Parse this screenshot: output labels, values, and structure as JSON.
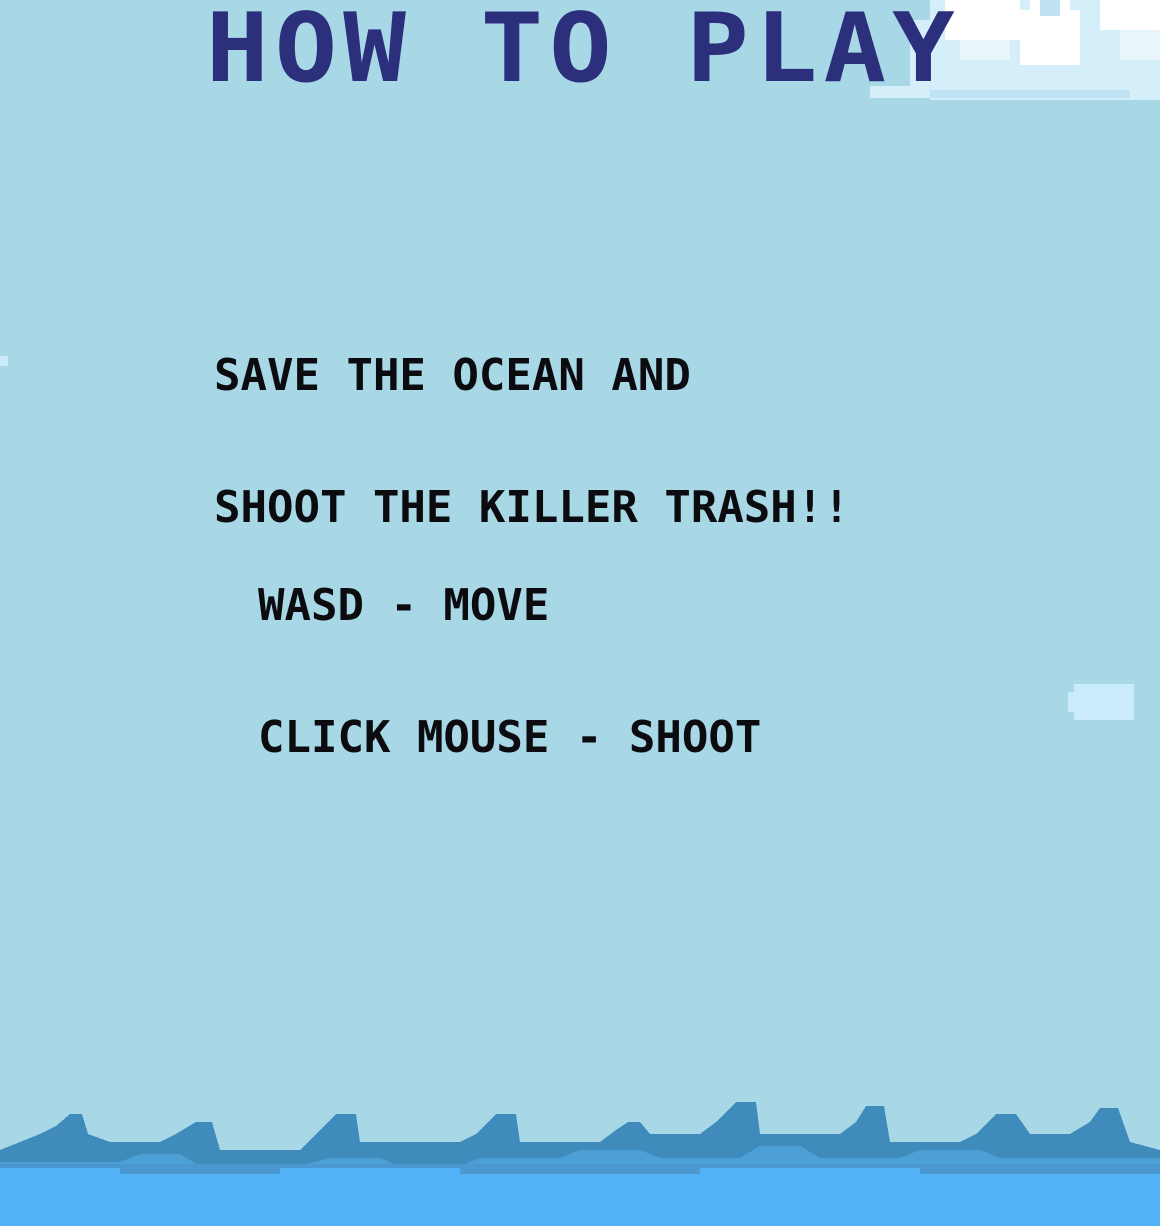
{
  "screen": {
    "title": "HOW TO PLAY",
    "tagline": [
      "SAVE THE OCEAN AND",
      "SHOOT THE KILLER TRASH!!"
    ],
    "controls": [
      "WASD - MOVE",
      "CLICK MOUSE - SHOOT"
    ]
  },
  "colors": {
    "sky": "#a8d7e6",
    "title": "#2b2f7c",
    "text": "#0c0c10",
    "cloud": "#ffffff",
    "cloud_shade": "#d4eefa",
    "wave_dark": "#3f8bbb",
    "wave_mid": "#4da0d6",
    "water": "#52b2f5"
  },
  "icons": [
    "cloud-sprite",
    "small-cloud-sprite",
    "ocean-waves"
  ]
}
